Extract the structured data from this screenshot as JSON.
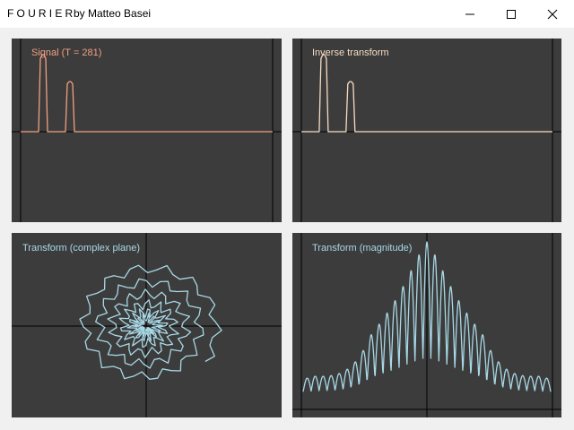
{
  "window": {
    "title": "FOURIER",
    "author": "by Matteo Basei",
    "controls": [
      "minimize-icon",
      "maximize-icon",
      "close-icon"
    ]
  },
  "colors": {
    "panel_bg": "#3c3c3c",
    "signal": "#f0a080",
    "inverse": "#f8dcc4",
    "transform": "#a8d8e6",
    "axis": "#000000"
  },
  "panels": {
    "signal": {
      "label": "Signal (T = 281)"
    },
    "inverse": {
      "label": "Inverse transform"
    },
    "complex": {
      "label": "Transform (complex plane)"
    },
    "magnitude": {
      "label": "Transform (magnitude)"
    }
  },
  "chart_data": [
    {
      "type": "line",
      "title": "Signal (T = 281)",
      "period": 281,
      "x": [
        0,
        20,
        22,
        24,
        26,
        28,
        30,
        50,
        52,
        54,
        56,
        58,
        60,
        281
      ],
      "y": [
        0,
        0,
        0.95,
        1.0,
        1.0,
        0.95,
        0,
        0,
        0.62,
        0.65,
        0.65,
        0.62,
        0,
        0
      ]
    },
    {
      "type": "line",
      "title": "Inverse transform",
      "x": [
        0,
        20,
        22,
        24,
        26,
        28,
        30,
        50,
        52,
        54,
        56,
        58,
        60,
        281
      ],
      "y": [
        0,
        0,
        0.95,
        1.0,
        1.0,
        0.95,
        0,
        0,
        0.62,
        0.65,
        0.65,
        0.62,
        0,
        0
      ]
    },
    {
      "type": "line",
      "title": "Transform (complex plane)",
      "note_shape": "spiral",
      "turns": 6
    },
    {
      "type": "line",
      "title": "Transform (magnitude)",
      "shape": "sinc-like",
      "peaks": 31
    }
  ]
}
